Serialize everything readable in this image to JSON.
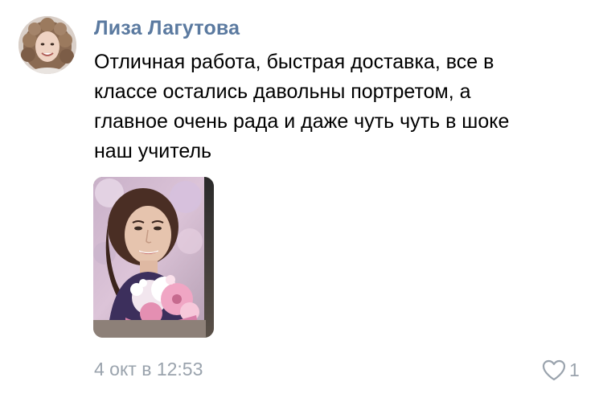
{
  "comment": {
    "author": "Лиза Лагутова",
    "text_lines": [
      "Отличная работа, быстрая доставка, все в",
      "классе остались давольны портретом, а",
      "главное очень рада и даже чуть чуть в шоке",
      "наш учитель"
    ],
    "date": "4 окт в 12:53",
    "likes": "1",
    "like_icon": "heart-outline-icon",
    "colors": {
      "author": "#5b7aa0",
      "meta": "#9aa3ad",
      "text": "#000000"
    }
  }
}
